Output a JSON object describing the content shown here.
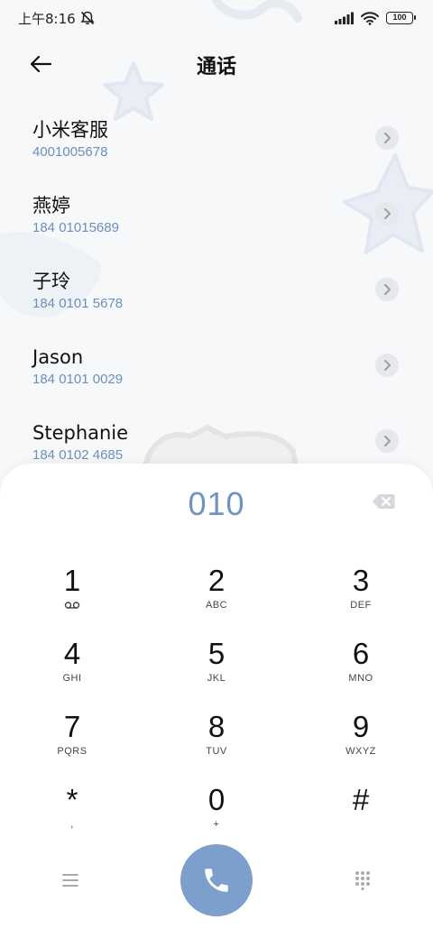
{
  "status_bar": {
    "time": "上午8:16",
    "icons": [
      "mute-bell-icon",
      "signal-icon",
      "wifi-icon",
      "battery-icon"
    ],
    "battery": "100"
  },
  "header": {
    "title": "通话",
    "back_icon": "arrow-left-icon"
  },
  "contacts": [
    {
      "name": "小米客服",
      "number": "4001005678"
    },
    {
      "name": "燕婷",
      "number": "184 01015689"
    },
    {
      "name": "子玲",
      "number": "184 0101 5678"
    },
    {
      "name": "Jason",
      "number": "184 0101 0029"
    },
    {
      "name": "Stephanie",
      "number": "184 0102 4685"
    }
  ],
  "dialpad": {
    "dialed": "010",
    "backspace_icon": "backspace-icon",
    "keys": [
      {
        "digit": "1",
        "letters": ""
      },
      {
        "digit": "2",
        "letters": "ABC"
      },
      {
        "digit": "3",
        "letters": "DEF"
      },
      {
        "digit": "4",
        "letters": "GHI"
      },
      {
        "digit": "5",
        "letters": "JKL"
      },
      {
        "digit": "6",
        "letters": "MNO"
      },
      {
        "digit": "7",
        "letters": "PQRS"
      },
      {
        "digit": "8",
        "letters": "TUV"
      },
      {
        "digit": "9",
        "letters": "WXYZ"
      },
      {
        "digit": "*",
        "letters": ","
      },
      {
        "digit": "0",
        "letters": "+"
      },
      {
        "digit": "#",
        "letters": ""
      }
    ]
  },
  "bottom_bar": {
    "menu_icon": "menu-icon",
    "call_icon": "phone-icon",
    "grid_icon": "dialpad-grid-icon"
  },
  "colors": {
    "accent": "#7d9fcc",
    "number_text": "#6b8fbf",
    "background": "#f7f8fa"
  }
}
